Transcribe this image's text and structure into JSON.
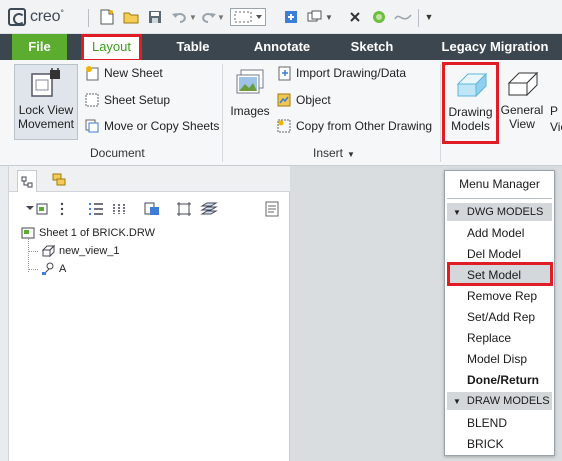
{
  "app": {
    "logo_text": "creo",
    "logo_mark": "°"
  },
  "quick_access": {
    "icons": [
      "new-file-icon",
      "open-folder-icon",
      "save-icon",
      "undo-icon",
      "redo-icon",
      "select-box-icon",
      "regenerate-icon",
      "windows-icon",
      "close-icon",
      "settings-icon",
      "curve-icon",
      "customize-icon"
    ]
  },
  "tabs": {
    "file": "File",
    "layout": "Layout",
    "table": "Table",
    "annotate": "Annotate",
    "sketch": "Sketch",
    "legacy_migration": "Legacy Migration"
  },
  "ribbon": {
    "document": {
      "label": "Document",
      "lock_view_movement": "Lock View Movement",
      "new_sheet": "New Sheet",
      "sheet_setup": "Sheet Setup",
      "move_or_copy_sheets": "Move or Copy Sheets"
    },
    "insert": {
      "label": "Insert",
      "images": "Images",
      "import_drawing_data": "Import Drawing/Data",
      "object": "Object",
      "copy_from_other_drawing": "Copy from Other Drawing"
    },
    "model_views": {
      "drawing_models": "Drawing Models",
      "general_view": "General View",
      "third_button_partial": "P Vie"
    }
  },
  "model_tree": {
    "items": [
      {
        "label": "Sheet 1 of BRICK.DRW",
        "icon": "sheet-icon"
      },
      {
        "label": "new_view_1",
        "icon": "view-icon"
      },
      {
        "label": "A",
        "icon": "annotation-icon"
      }
    ]
  },
  "menu_manager": {
    "title": "Menu Manager",
    "dwg_models": {
      "header": "DWG MODELS",
      "items": [
        "Add Model",
        "Del Model",
        "Set Model",
        "Remove Rep",
        "Set/Add Rep",
        "Replace",
        "Model Disp",
        "Done/Return"
      ],
      "selected": "Set Model"
    },
    "draw_models": {
      "header": "DRAW MODELS",
      "items": [
        "BLEND",
        "BRICK"
      ]
    }
  },
  "colors": {
    "tabbar": "#3b464f",
    "file_tab": "#5cac2f",
    "layout_text": "#3a9f1d",
    "highlight_red": "#e01c24"
  }
}
